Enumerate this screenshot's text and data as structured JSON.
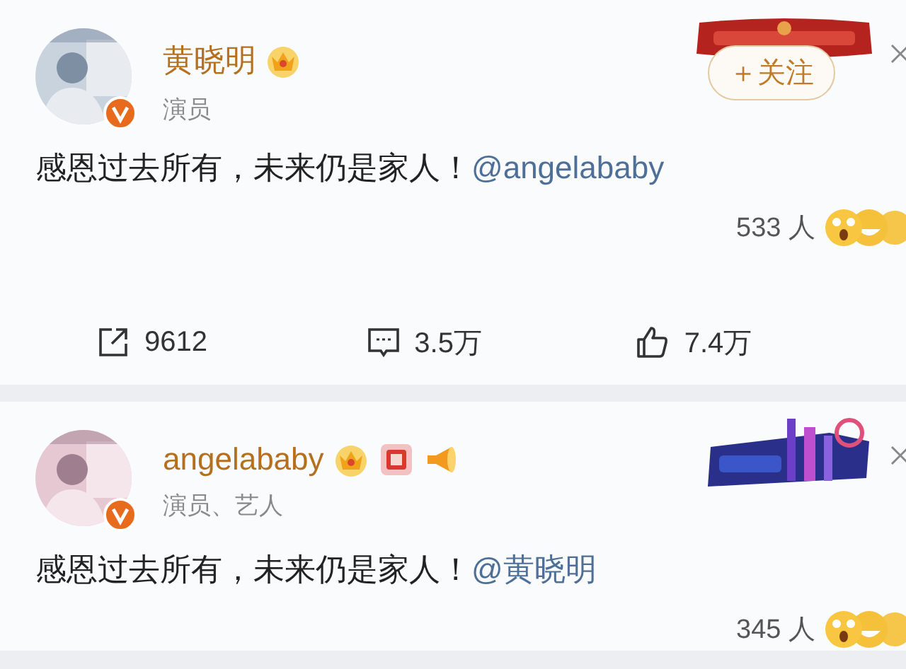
{
  "posts": [
    {
      "author": {
        "name": "黄晓明",
        "title": "演员",
        "verified": true
      },
      "name_badges": [
        {
          "kind": "crown"
        }
      ],
      "follow_button": "＋关注",
      "content": "感恩过去所有，未来仍是家人！",
      "mention": "@angelababy",
      "reaction_count": "533 人",
      "actions": [
        {
          "kind": "repost",
          "count": "9612"
        },
        {
          "kind": "comment",
          "count": "3.5万"
        },
        {
          "kind": "like",
          "count": "7.4万"
        }
      ]
    },
    {
      "author": {
        "name": "angelababy",
        "title": "演员、艺人",
        "verified": true
      },
      "name_badges": [
        {
          "kind": "crown"
        },
        {
          "kind": "fu"
        },
        {
          "kind": "megaphone"
        }
      ],
      "content": "感恩过去所有，未来仍是家人！",
      "mention": "@黄晓明",
      "reaction_count": "345 人"
    }
  ]
}
